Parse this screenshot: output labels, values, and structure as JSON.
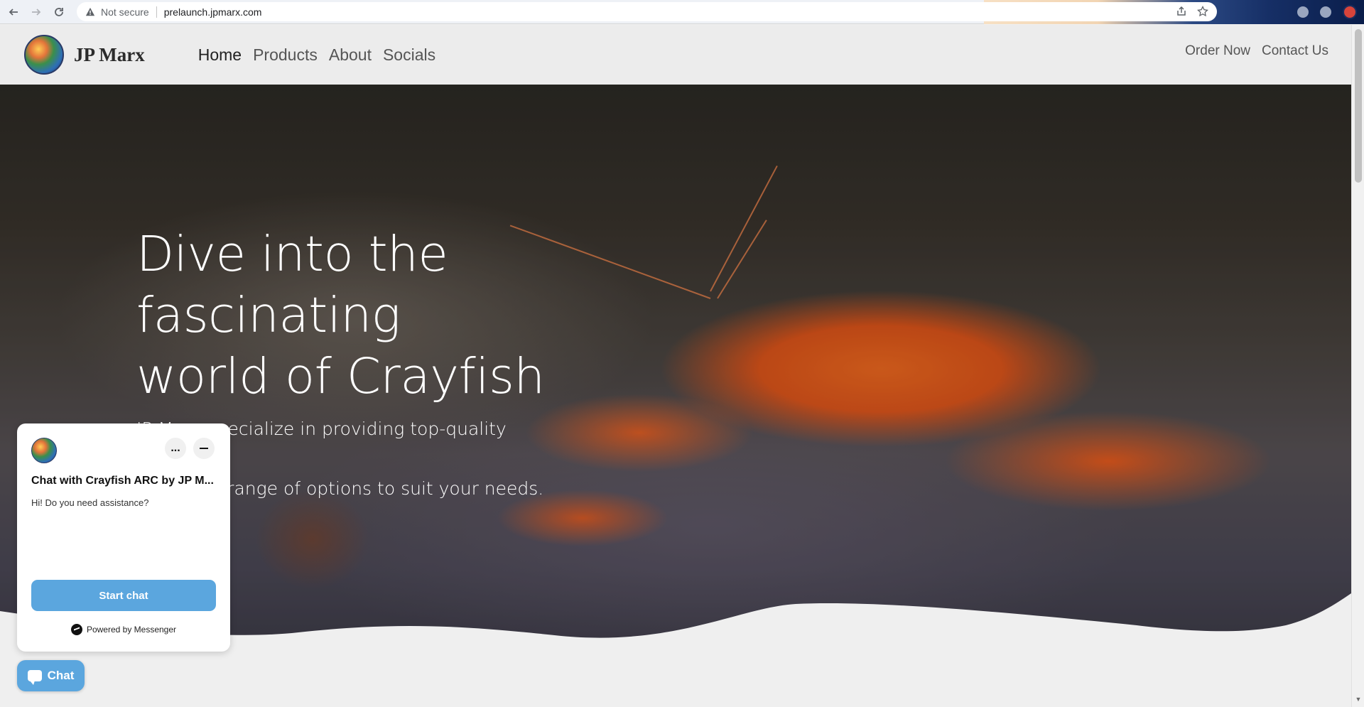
{
  "browser": {
    "security_label": "Not secure",
    "url": "prelaunch.jpmarx.com",
    "icons": [
      "back-icon",
      "forward-icon",
      "reload-icon",
      "warning-icon",
      "share-icon",
      "star-icon"
    ]
  },
  "site": {
    "brand": "JP Marx",
    "nav": [
      {
        "label": "Home",
        "active": true
      },
      {
        "label": "Products"
      },
      {
        "label": "About"
      },
      {
        "label": "Socials"
      }
    ],
    "right_nav": [
      {
        "label": "Order Now"
      },
      {
        "label": "Contact Us"
      }
    ]
  },
  "hero": {
    "title_line1": "Dive into the fascinating",
    "title_line2": "world of Crayfish",
    "subtitle_line1": "JP Marx specialize in providing top-quality crayfish,",
    "subtitle_line2": "offering a range of options to suit your needs."
  },
  "chat": {
    "title": "Chat with Crayfish ARC by JP M...",
    "message": "Hi! Do you need assistance?",
    "start_label": "Start chat",
    "powered_label": "Powered by Messenger",
    "fab_label": "Chat",
    "more_label": "..."
  },
  "colors": {
    "accent": "#5ba6de",
    "header_bg": "#ececec",
    "crayfish": "#ff6a1a"
  }
}
